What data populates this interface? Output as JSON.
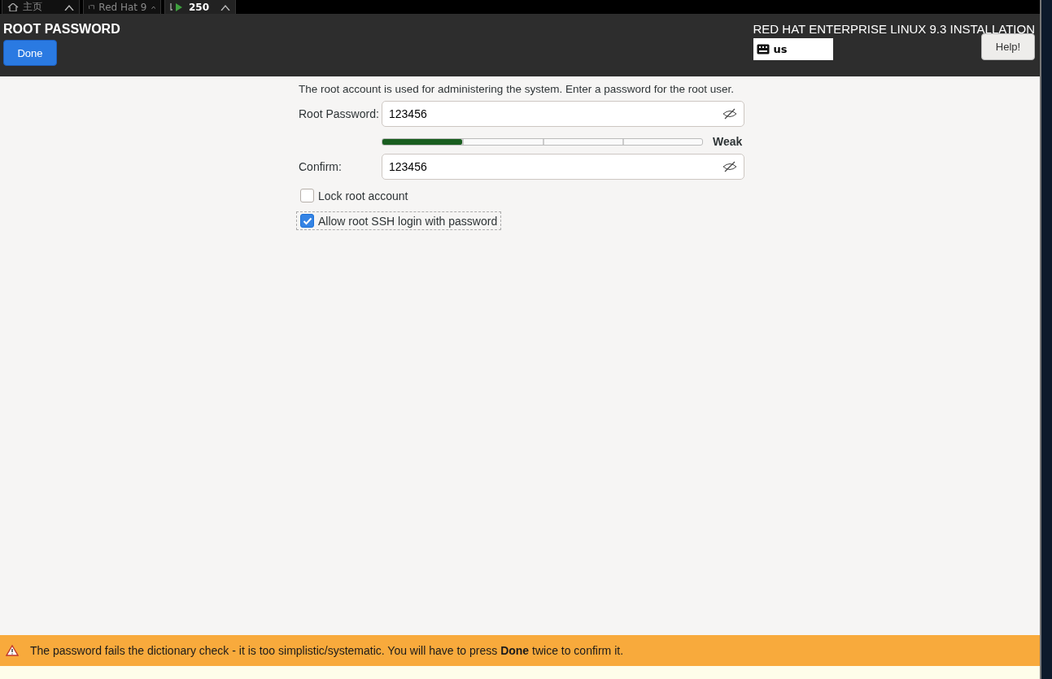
{
  "vm_tabs": [
    {
      "label": "主页",
      "selected": false
    },
    {
      "label": "Red Hat 9",
      "selected": false
    },
    {
      "label": "250",
      "selected": true
    }
  ],
  "header": {
    "title": "ROOT PASSWORD",
    "done_button": "Done",
    "product": "RED HAT ENTERPRISE LINUX 9.3 INSTALLATION",
    "keyboard_layout": "us",
    "help_button": "Help!"
  },
  "intro": "The root account is used for administering the system.  Enter a password for the root user.",
  "password": {
    "label": "Root Password:",
    "value": "123456"
  },
  "strength": {
    "level": 0.25,
    "reading": "Weak"
  },
  "confirm": {
    "label": "Confirm:",
    "value": "123456"
  },
  "options": [
    {
      "label": "Lock root account",
      "checked": false,
      "focused": false
    },
    {
      "label": "Allow root SSH login with password",
      "checked": true,
      "focused": true
    }
  ],
  "warning": "The password fails the dictionary check - it is too simplistic/systematic. You will have to press **Done** twice to confirm it."
}
